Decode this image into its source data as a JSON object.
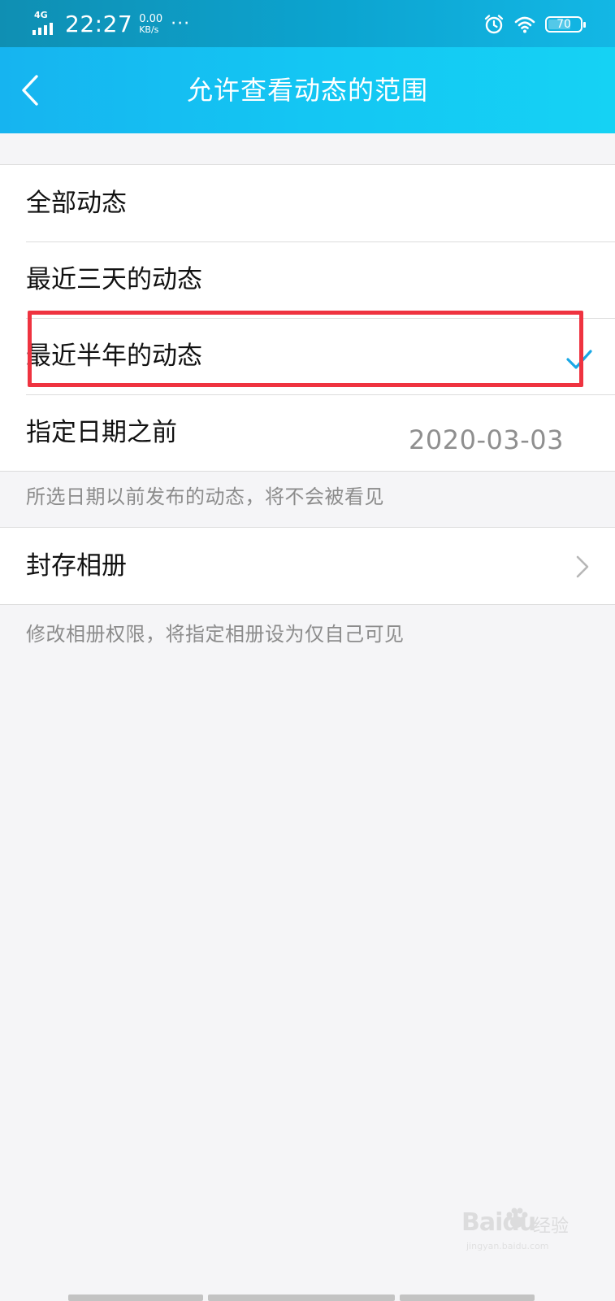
{
  "status_bar": {
    "network": "4G",
    "time": "22:27",
    "speed_value": "0.00",
    "speed_unit": "KB/s",
    "more": "···",
    "battery": "70",
    "battery_level": 0.7
  },
  "header": {
    "title": "允许查看动态的范围",
    "back_icon": "chevron-left-icon"
  },
  "range_options": [
    {
      "label": "全部动态",
      "selected": false
    },
    {
      "label": "最近三天的动态",
      "selected": false
    },
    {
      "label": "最近半年的动态",
      "selected": true
    },
    {
      "label": "指定日期之前",
      "value": "2020-03-03",
      "selected": false
    }
  ],
  "range_hint": "所选日期以前发布的动态，将不会被看见",
  "album": {
    "label": "封存相册",
    "hint": "修改相册权限，将指定相册设为仅自己可见"
  },
  "colors": {
    "header": "#14c6f3",
    "check": "#1aa8e6",
    "highlight": "#ef3340",
    "background": "#f5f5f7"
  },
  "watermark": {
    "logo": "Baidu",
    "brand": "经验",
    "url": "jingyan.baidu.com"
  }
}
